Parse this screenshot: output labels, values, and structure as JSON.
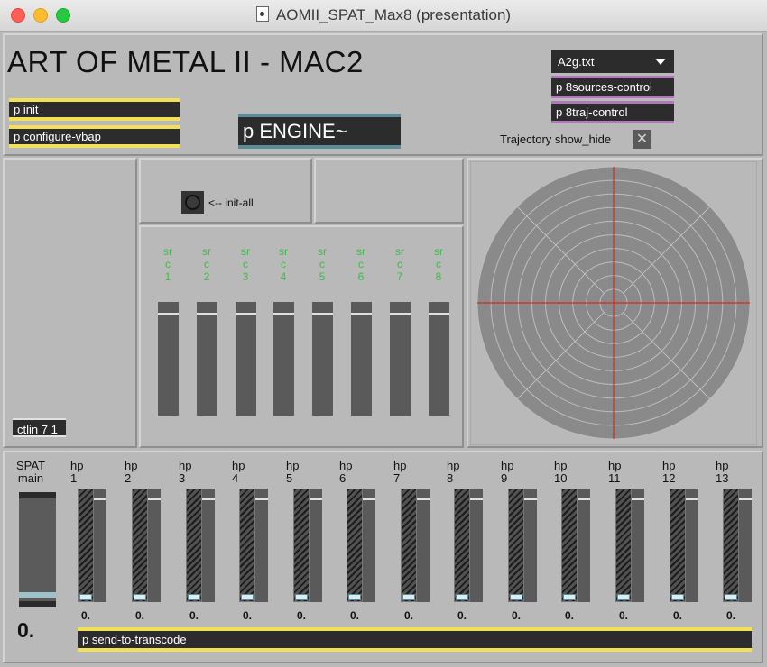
{
  "window": {
    "title": "AOMII_SPAT_Max8 (presentation)"
  },
  "header": {
    "title": "ART OF METAL II - MAC2",
    "p_init": "p init",
    "p_configure": "p configure-vbap",
    "p_engine": "p ENGINE~",
    "menu_value": "A2g.txt",
    "p_sources": "p 8sources-control",
    "p_traj": "p 8traj-control",
    "traj_label": "Trajectory show_hide",
    "traj_toggle_icon": "x-toggle-icon"
  },
  "controls": {
    "init_all_label": "<-- init-all",
    "ctlin": "ctlin 7 1"
  },
  "sources": [
    {
      "l1": "sr",
      "l2": "c",
      "l3": "1"
    },
    {
      "l1": "sr",
      "l2": "c",
      "l3": "2"
    },
    {
      "l1": "sr",
      "l2": "c",
      "l3": "3"
    },
    {
      "l1": "sr",
      "l2": "c",
      "l3": "4"
    },
    {
      "l1": "sr",
      "l2": "c",
      "l3": "5"
    },
    {
      "l1": "sr",
      "l2": "c",
      "l3": "6"
    },
    {
      "l1": "sr",
      "l2": "c",
      "l3": "7"
    },
    {
      "l1": "sr",
      "l2": "c",
      "l3": "8"
    }
  ],
  "main": {
    "l1": "SPAT",
    "l2": "main",
    "value": "0."
  },
  "speakers": [
    {
      "l1": "hp",
      "l2": "1",
      "value": "0."
    },
    {
      "l1": "hp",
      "l2": "2",
      "value": "0."
    },
    {
      "l1": "hp",
      "l2": "3",
      "value": "0."
    },
    {
      "l1": "hp",
      "l2": "4",
      "value": "0."
    },
    {
      "l1": "hp",
      "l2": "5",
      "value": "0."
    },
    {
      "l1": "hp",
      "l2": "6",
      "value": "0."
    },
    {
      "l1": "hp",
      "l2": "7",
      "value": "0."
    },
    {
      "l1": "hp",
      "l2": "8",
      "value": "0."
    },
    {
      "l1": "hp",
      "l2": "9",
      "value": "0."
    },
    {
      "l1": "hp",
      "l2": "10",
      "value": "0."
    },
    {
      "l1": "hp",
      "l2": "11",
      "value": "0."
    },
    {
      "l1": "hp",
      "l2": "12",
      "value": "0."
    },
    {
      "l1": "hp",
      "l2": "13",
      "value": "0."
    }
  ],
  "footer": {
    "p_send": "p send-to-transcode"
  },
  "colors": {
    "accent_yellow": "#f1e05a",
    "accent_teal": "#5a8d97",
    "accent_purple": "#b07ab8",
    "source_green": "#3cbd46",
    "crosshair_red": "#d42a1e"
  }
}
